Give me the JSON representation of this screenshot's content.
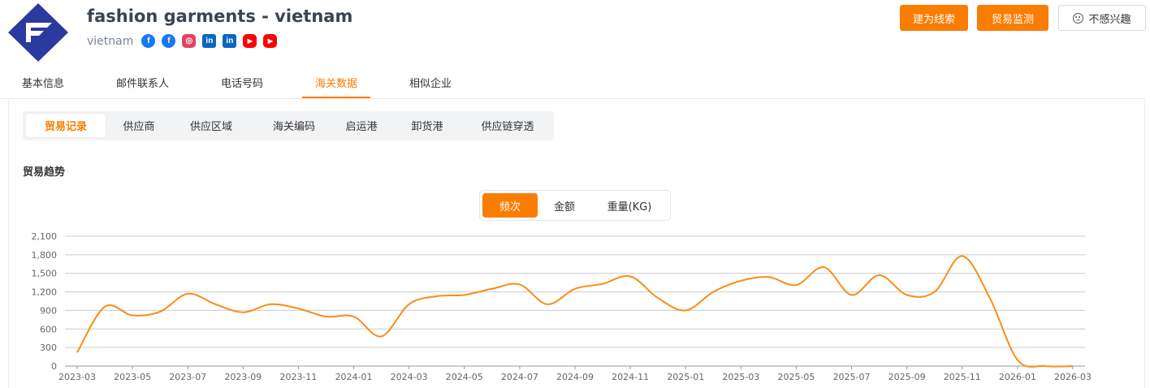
{
  "company": {
    "name": "fashion garments - vietnam",
    "country": "vietnam",
    "social": [
      {
        "icon": "facebook-icon",
        "glyph": "f",
        "class": "s-fb"
      },
      {
        "icon": "facebook-icon",
        "glyph": "f",
        "class": "s-fb"
      },
      {
        "icon": "instagram-icon",
        "glyph": "◎",
        "class": "s-ig"
      },
      {
        "icon": "linkedin-icon",
        "glyph": "in",
        "class": "s-li"
      },
      {
        "icon": "linkedin-icon",
        "glyph": "in",
        "class": "s-li"
      },
      {
        "icon": "youtube-icon",
        "glyph": "▶",
        "class": "s-yt"
      },
      {
        "icon": "youtube-icon",
        "glyph": "▶",
        "class": "s-yt"
      }
    ]
  },
  "actions": {
    "create_lead": "建为线索",
    "trade_monitor": "贸易监测",
    "not_interested": "不感兴趣"
  },
  "main_tabs": [
    "基本信息",
    "邮件联系人",
    "电话号码",
    "海关数据",
    "相似企业"
  ],
  "main_tab_active": 3,
  "sub_tabs": [
    "贸易记录",
    "供应商",
    "供应区域",
    "海关编码",
    "启运港",
    "卸货港",
    "供应链穿透"
  ],
  "sub_tab_active": 0,
  "section_title": "贸易趋势",
  "metrics": [
    "频次",
    "金额",
    "重量(KG)"
  ],
  "metric_active": 0,
  "colors": {
    "accent": "#fa7d00",
    "line": "#fa8c16",
    "grid": "#cccccc"
  },
  "chart_data": {
    "type": "line",
    "ylim": [
      0,
      2100
    ],
    "yticks": [
      "0",
      "300",
      "600",
      "900",
      "1,200",
      "1,500",
      "1,800",
      "2,100"
    ],
    "xticks": [
      "2023-03",
      "2023-05",
      "2023-07",
      "2023-09",
      "2023-11",
      "2024-01",
      "2024-03",
      "2024-05",
      "2024-07",
      "2024-09",
      "2024-11",
      "2025-01",
      "2025-03",
      "2025-05",
      "2025-07",
      "2025-09",
      "2025-11",
      "2026-01",
      "2026-03"
    ],
    "x": [
      "2023-03",
      "2023-04",
      "2023-05",
      "2023-06",
      "2023-07",
      "2023-08",
      "2023-09",
      "2023-10",
      "2023-11",
      "2023-12",
      "2024-01",
      "2024-02",
      "2024-03",
      "2024-04",
      "2024-05",
      "2024-06",
      "2024-07",
      "2024-08",
      "2024-09",
      "2024-10",
      "2024-11",
      "2024-12",
      "2025-01",
      "2025-02",
      "2025-03",
      "2025-04",
      "2025-05",
      "2025-06",
      "2025-07",
      "2025-08",
      "2025-09",
      "2025-10",
      "2025-11",
      "2025-12",
      "2026-01",
      "2026-02",
      "2026-03"
    ],
    "values": [
      220,
      960,
      820,
      880,
      1170,
      1000,
      870,
      1000,
      930,
      800,
      800,
      480,
      1000,
      1130,
      1150,
      1250,
      1320,
      1000,
      1250,
      1330,
      1450,
      1100,
      900,
      1200,
      1380,
      1440,
      1310,
      1600,
      1150,
      1470,
      1150,
      1200,
      1780,
      1100,
      100,
      0,
      0
    ]
  }
}
